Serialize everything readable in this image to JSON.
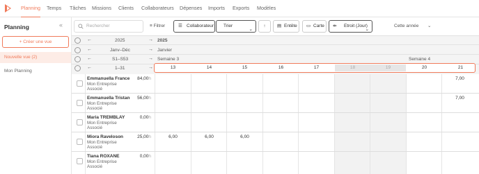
{
  "nav": {
    "items": [
      "Planning",
      "Temps",
      "Tâches",
      "Missions",
      "Clients",
      "Collaborateurs",
      "Dépenses",
      "Imports",
      "Exports",
      "Modèles"
    ],
    "active": "Planning"
  },
  "sidebar": {
    "title": "Planning",
    "create_label": "+ Créer une vue",
    "views": [
      "Nouvelle vue (2)",
      "Mon Planning"
    ]
  },
  "toolbar": {
    "search_placeholder": "Rechercher",
    "filter_label": "Filtrer",
    "group_label": "Collaborateur",
    "sort_label": "Trier",
    "header_label": "Entête",
    "card_label": "Carte",
    "density_label": "Etroit (Jour)",
    "period_label": "Cette année"
  },
  "timeline": {
    "year_label": "2025",
    "year_value": "2025",
    "month_label": "Janv–Déc",
    "month_value": "Janvier",
    "week_label": "S1–S53",
    "weeks": [
      "Semaine 3",
      "Semaine 4"
    ],
    "day_label": "1–31",
    "days": [
      "13",
      "14",
      "15",
      "16",
      "17",
      "18",
      "19",
      "20",
      "21"
    ]
  },
  "employees": [
    {
      "name": "Emmanuella France",
      "company": "Mon Entreprise",
      "role": "Associé",
      "total": "84,00",
      "unit": "h",
      "values": [
        "",
        "",
        "",
        "",
        "",
        "",
        "",
        "7,00"
      ]
    },
    {
      "name": "Emmanuella Tristan",
      "company": "Mon Entreprise",
      "role": "Associé",
      "total": "56,00",
      "unit": "h",
      "values": [
        "",
        "",
        "",
        "",
        "",
        "",
        "",
        "7,00"
      ]
    },
    {
      "name": "Maria TREMBLAY",
      "company": "Mon Entreprise",
      "role": "Associé",
      "total": "0,00",
      "unit": "h",
      "values": [
        "",
        "",
        "",
        "",
        "",
        "",
        "",
        ""
      ]
    },
    {
      "name": "Miora Raveloson",
      "company": "Mon Entreprise",
      "role": "Associé",
      "total": "25,00",
      "unit": "h",
      "values": [
        "6,00",
        "6,00",
        "6,00",
        "",
        "",
        "",
        "",
        ""
      ]
    },
    {
      "name": "Tiana ROXANE",
      "company": "Mon Entreprise",
      "role": "Associé",
      "total": "0,00",
      "unit": "h",
      "values": [
        "",
        "",
        "",
        "",
        "",
        "",
        "",
        ""
      ]
    }
  ],
  "colors": {
    "accent": "#f07a5a"
  }
}
